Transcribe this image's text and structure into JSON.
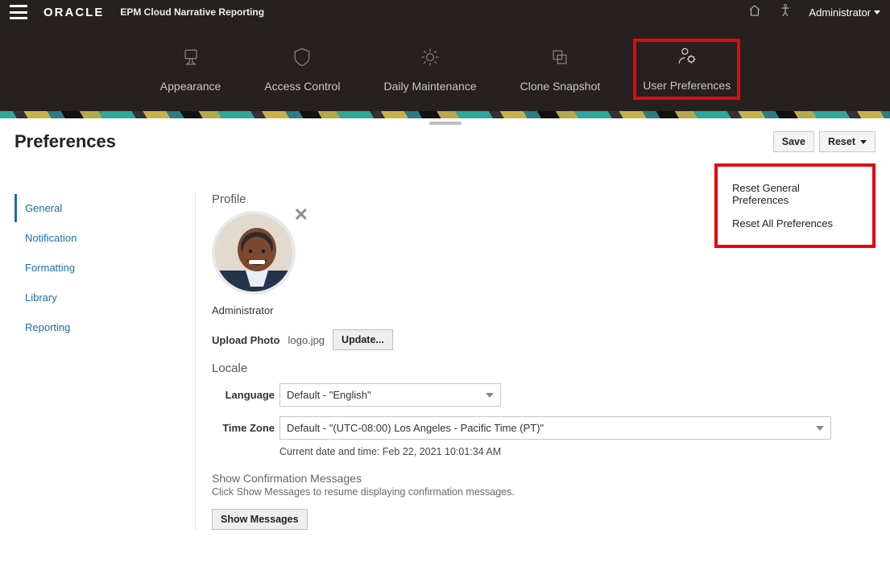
{
  "header": {
    "brand": "ORACLE",
    "product": "EPM Cloud Narrative Reporting",
    "user_label": "Administrator"
  },
  "nav": {
    "items": [
      {
        "label": "Appearance"
      },
      {
        "label": "Access Control"
      },
      {
        "label": "Daily Maintenance"
      },
      {
        "label": "Clone Snapshot"
      },
      {
        "label": "User Preferences"
      }
    ]
  },
  "page": {
    "title": "Preferences",
    "save_label": "Save",
    "reset_label": "Reset"
  },
  "reset_menu": {
    "general": "Reset General Preferences",
    "all": "Reset All Preferences"
  },
  "sidebar": {
    "items": [
      {
        "label": "General"
      },
      {
        "label": "Notification"
      },
      {
        "label": "Formatting"
      },
      {
        "label": "Library"
      },
      {
        "label": "Reporting"
      }
    ]
  },
  "profile": {
    "section": "Profile",
    "username": "Administrator",
    "upload_label": "Upload Photo",
    "filename": "logo.jpg",
    "update_btn": "Update..."
  },
  "locale": {
    "section": "Locale",
    "language_label": "Language",
    "language_value": "Default - \"English\"",
    "timezone_label": "Time Zone",
    "timezone_value": "Default - \"(UTC-08:00) Los Angeles - Pacific Time (PT)\"",
    "current_dt": "Current date and time: Feb 22, 2021 10:01:34 AM"
  },
  "confirm": {
    "heading": "Show Confirmation Messages",
    "sub": "Click Show Messages to resume displaying confirmation messages.",
    "btn": "Show Messages"
  }
}
